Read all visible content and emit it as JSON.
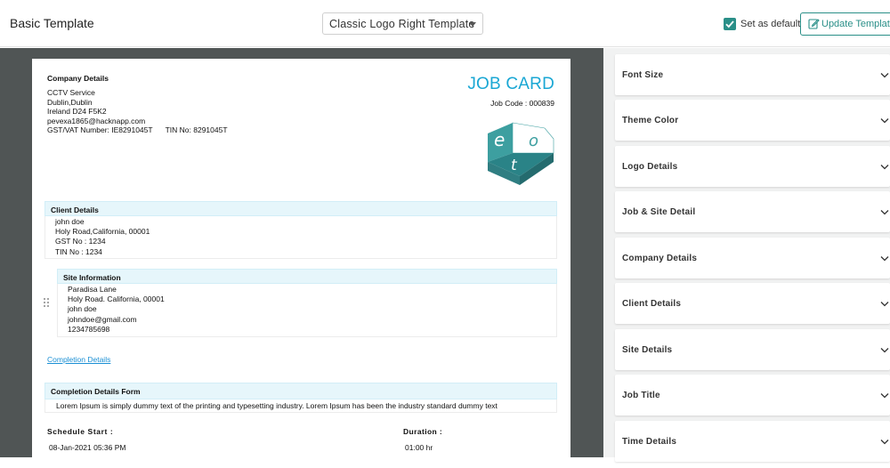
{
  "header": {
    "title": "Basic Template",
    "template_select": "Classic Logo Right Template",
    "set_default_label": "Set as default",
    "set_default_checked": true,
    "update_button": "Update Template"
  },
  "colors": {
    "accent": "#2a8f88",
    "job_card_title": "#1aa7d4",
    "section_header_bg": "#e6f6fb",
    "canvas_bg": "#505555",
    "panel_bg": "#f1f2f2",
    "link": "#1a8fd4"
  },
  "document": {
    "company": {
      "title": "Company Details",
      "name": "CCTV Service",
      "address1": "Dublin,Dublin",
      "address2": "Ireland D24 F5K2",
      "email": "pevexa1865@hacknapp.com",
      "vat": "GST/VAT Number: IE8291045T",
      "tin": "TIN No: 8291045T"
    },
    "job_card_title": "JOB CARD",
    "job_code": "Job Code : 000839",
    "logo_icon": "eot-cube-logo",
    "client": {
      "title": "Client Details",
      "name": "john doe",
      "address": "Holy Road,California, 00001",
      "gst": "GST No : 1234",
      "tin": "TIN No : 1234"
    },
    "site": {
      "title": "Site Information",
      "name": "Paradisa Lane",
      "address": "Holy Road. California, 00001",
      "contact": "john doe",
      "email": "johndoe@gmail.com",
      "phone": "1234785698"
    },
    "completion_link": "Completion Details",
    "completion_form": {
      "title": "Completion Details Form",
      "text": "Lorem Ipsum is simply dummy text of the printing and typesetting industry. Lorem Ipsum has been the industry standard dummy text"
    },
    "schedule": {
      "start_label": "Schedule Start :",
      "start_value": "08-Jan-2021 05:36 PM",
      "duration_label": "Duration :",
      "duration_value": "01:00 hr"
    }
  },
  "settings_panel": {
    "items": [
      {
        "label": "Font Size"
      },
      {
        "label": "Theme Color"
      },
      {
        "label": "Logo Details"
      },
      {
        "label": "Job & Site Detail"
      },
      {
        "label": "Company Details"
      },
      {
        "label": "Client Details"
      },
      {
        "label": "Site Details"
      },
      {
        "label": "Job Title"
      },
      {
        "label": "Time Details"
      }
    ]
  }
}
